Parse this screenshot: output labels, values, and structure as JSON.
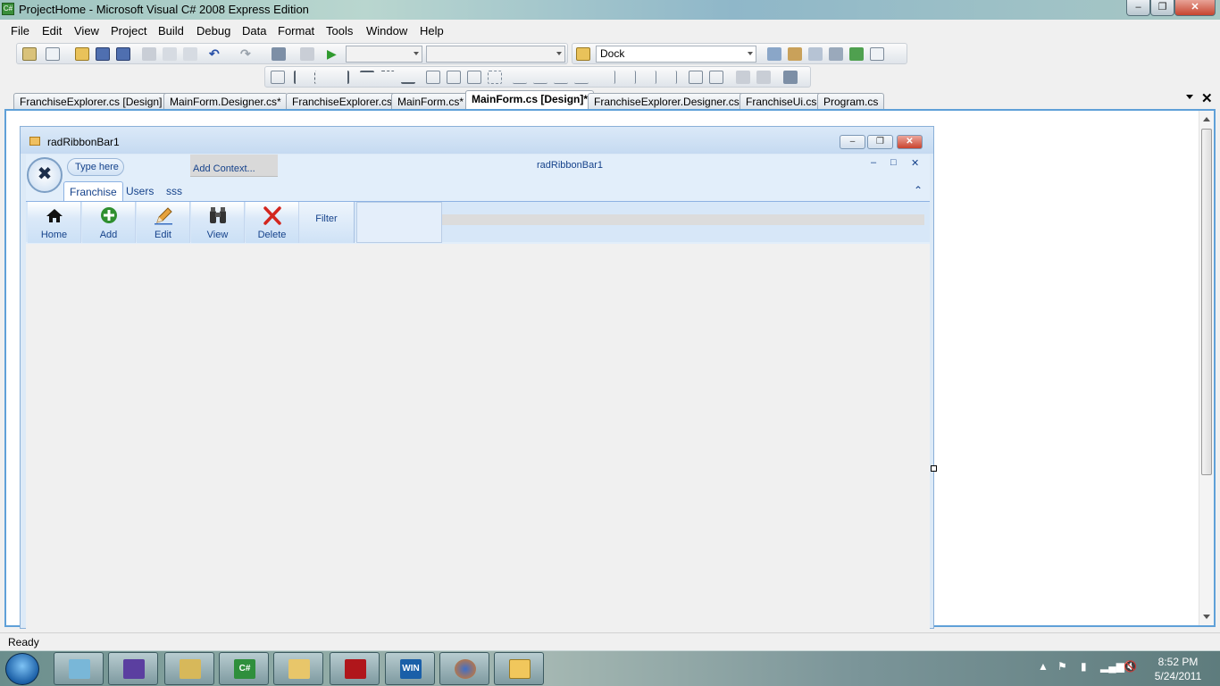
{
  "window": {
    "title": "ProjectHome - Microsoft Visual C# 2008 Express Edition"
  },
  "menu": [
    "File",
    "Edit",
    "View",
    "Project",
    "Build",
    "Debug",
    "Data",
    "Format",
    "Tools",
    "Window",
    "Help"
  ],
  "toolbar": {
    "dock_value": "Dock"
  },
  "doc_tabs": [
    "FranchiseExplorer.cs [Design]",
    "MainForm.Designer.cs*",
    "FranchiseExplorer.cs",
    "MainForm.cs*",
    "MainForm.cs [Design]*",
    "FranchiseExplorer.Designer.cs",
    "FranchiseUi.cs",
    "Program.cs"
  ],
  "form": {
    "title": "radRibbonBar1",
    "qat_placeholder": "Type here",
    "add_context": "Add Context...",
    "ribbon_title": "radRibbonBar1",
    "tabs": [
      "Franchise",
      "Users",
      "sss"
    ],
    "buttons": [
      "Home",
      "Add",
      "Edit",
      "View",
      "Delete"
    ],
    "filter_label": "Filter"
  },
  "status": {
    "text": "Ready"
  },
  "clock": {
    "time": "8:52 PM",
    "date": "5/24/2011"
  },
  "taskbar_labels": {
    "csharp": "C#",
    "win": "WIN"
  },
  "colors": {
    "accent": "#15428b",
    "selection_border": "#5fa0d8"
  }
}
